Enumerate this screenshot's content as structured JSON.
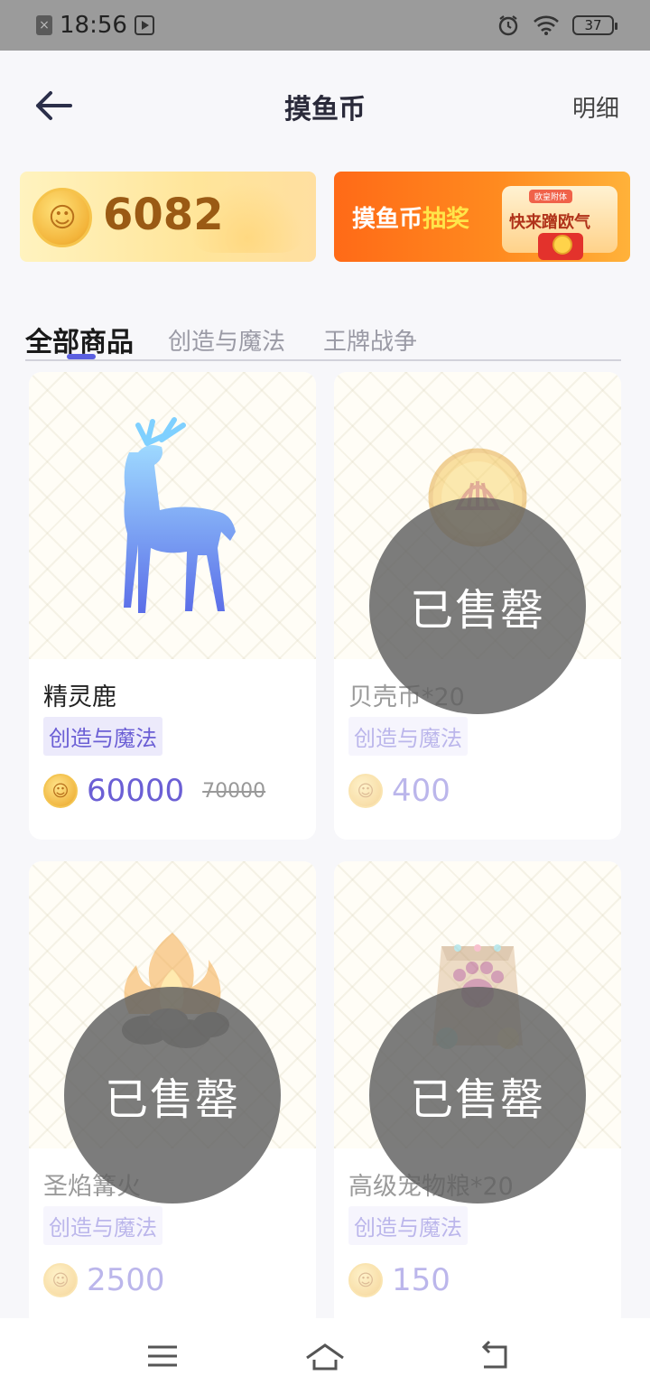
{
  "status_bar": {
    "time": "18:56",
    "battery": "37",
    "icons": [
      "notification-x-icon",
      "media-play-icon",
      "alarm-icon",
      "wifi-icon",
      "battery-icon"
    ]
  },
  "header": {
    "title": "摸鱼币",
    "detail_label": "明细",
    "back_icon": "arrow-left-icon"
  },
  "coin_card": {
    "amount": "6082",
    "coin_glyph": "☺"
  },
  "lottery_banner": {
    "text_main": "摸鱼币",
    "text_highlight": "抽奖",
    "box_tag": "欧皇附体",
    "box_text": "快来蹭欧气"
  },
  "tabs": [
    {
      "label": "全部商品",
      "active": true
    },
    {
      "label": "创造与魔法",
      "active": false
    },
    {
      "label": "王牌战争",
      "active": false
    }
  ],
  "products": [
    {
      "name": "精灵鹿",
      "tag": "创造与魔法",
      "price": "60000",
      "original_price": "70000",
      "sold_out": false,
      "art_icon": "spirit-deer-icon"
    },
    {
      "name": "贝壳币*20",
      "tag": "创造与魔法",
      "price": "400",
      "original_price": "",
      "sold_out": true,
      "art_icon": "shell-coin-icon"
    },
    {
      "name": "圣焰篝火",
      "tag": "创造与魔法",
      "price": "2500",
      "original_price": "",
      "sold_out": true,
      "art_icon": "bonfire-icon"
    },
    {
      "name": "高级宠物粮*20",
      "tag": "创造与魔法",
      "price": "150",
      "original_price": "",
      "sold_out": true,
      "art_icon": "pet-food-bag-icon"
    }
  ],
  "sold_out_label": "已售罄",
  "nav_bar": {
    "icons": [
      "menu-icon",
      "home-icon",
      "back-nav-icon"
    ]
  },
  "colors": {
    "accent": "#6b5fd5",
    "tab_indicator": "#5b5fe0",
    "coin_text": "#9a5a14",
    "banner_orange": "#ff6a17"
  }
}
